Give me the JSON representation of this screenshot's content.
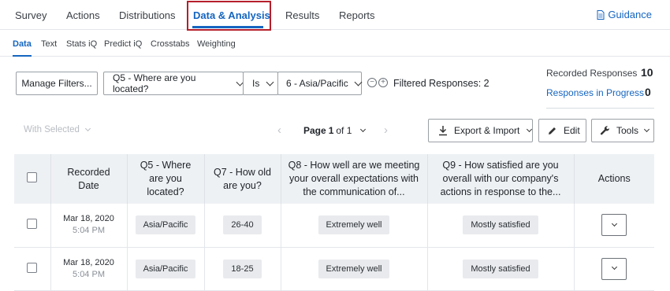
{
  "top_nav": {
    "tabs": [
      "Survey",
      "Actions",
      "Distributions",
      "Data & Analysis",
      "Results",
      "Reports"
    ],
    "active": "Data & Analysis",
    "guidance_label": "Guidance"
  },
  "sub_nav": {
    "tabs": [
      "Data",
      "Text",
      "Stats iQ",
      "Predict iQ",
      "Crosstabs",
      "Weighting"
    ],
    "active": "Data"
  },
  "filters": {
    "manage_label": "Manage Filters...",
    "question": "Q5 - Where are you located?",
    "operator": "Is",
    "value": "6 - Asia/Pacific",
    "filtered_label": "Filtered Responses: 2"
  },
  "summary": {
    "recorded_label": "Recorded Responses",
    "recorded_value": "10",
    "in_progress_label": "Responses in Progress",
    "in_progress_value": "0"
  },
  "toolbar": {
    "with_selected": "With Selected",
    "page_label": "Page",
    "page_current": "1",
    "page_of": "of 1",
    "export_label": "Export & Import",
    "edit_label": "Edit",
    "tools_label": "Tools"
  },
  "table": {
    "headers": {
      "date": "Recorded Date",
      "q5": "Q5 - Where are you located?",
      "q7": "Q7 - How old are you?",
      "q8": "Q8 - How well are we meeting your overall expectations with the communication of...",
      "q9": "Q9 - How satisfied are you overall with our company's actions in response to the...",
      "actions": "Actions"
    },
    "rows": [
      {
        "date": "Mar 18, 2020",
        "time": "5:04 PM",
        "q5": "Asia/Pacific",
        "q7": "26-40",
        "q8": "Extremely well",
        "q9": "Mostly satisfied"
      },
      {
        "date": "Mar 18, 2020",
        "time": "5:04 PM",
        "q5": "Asia/Pacific",
        "q7": "18-25",
        "q8": "Extremely well",
        "q9": "Mostly satisfied"
      }
    ]
  },
  "colors": {
    "accent": "#1565c0",
    "highlight": "#b51f2b"
  }
}
